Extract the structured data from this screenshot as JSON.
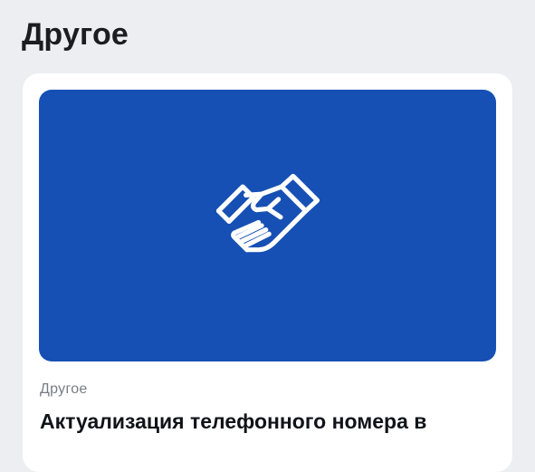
{
  "section": {
    "title": "Другое"
  },
  "card": {
    "category": "Другое",
    "title": "Актуализация телефонного номера в",
    "banner_color": "#1650b4",
    "icon": "handshake-icon"
  }
}
